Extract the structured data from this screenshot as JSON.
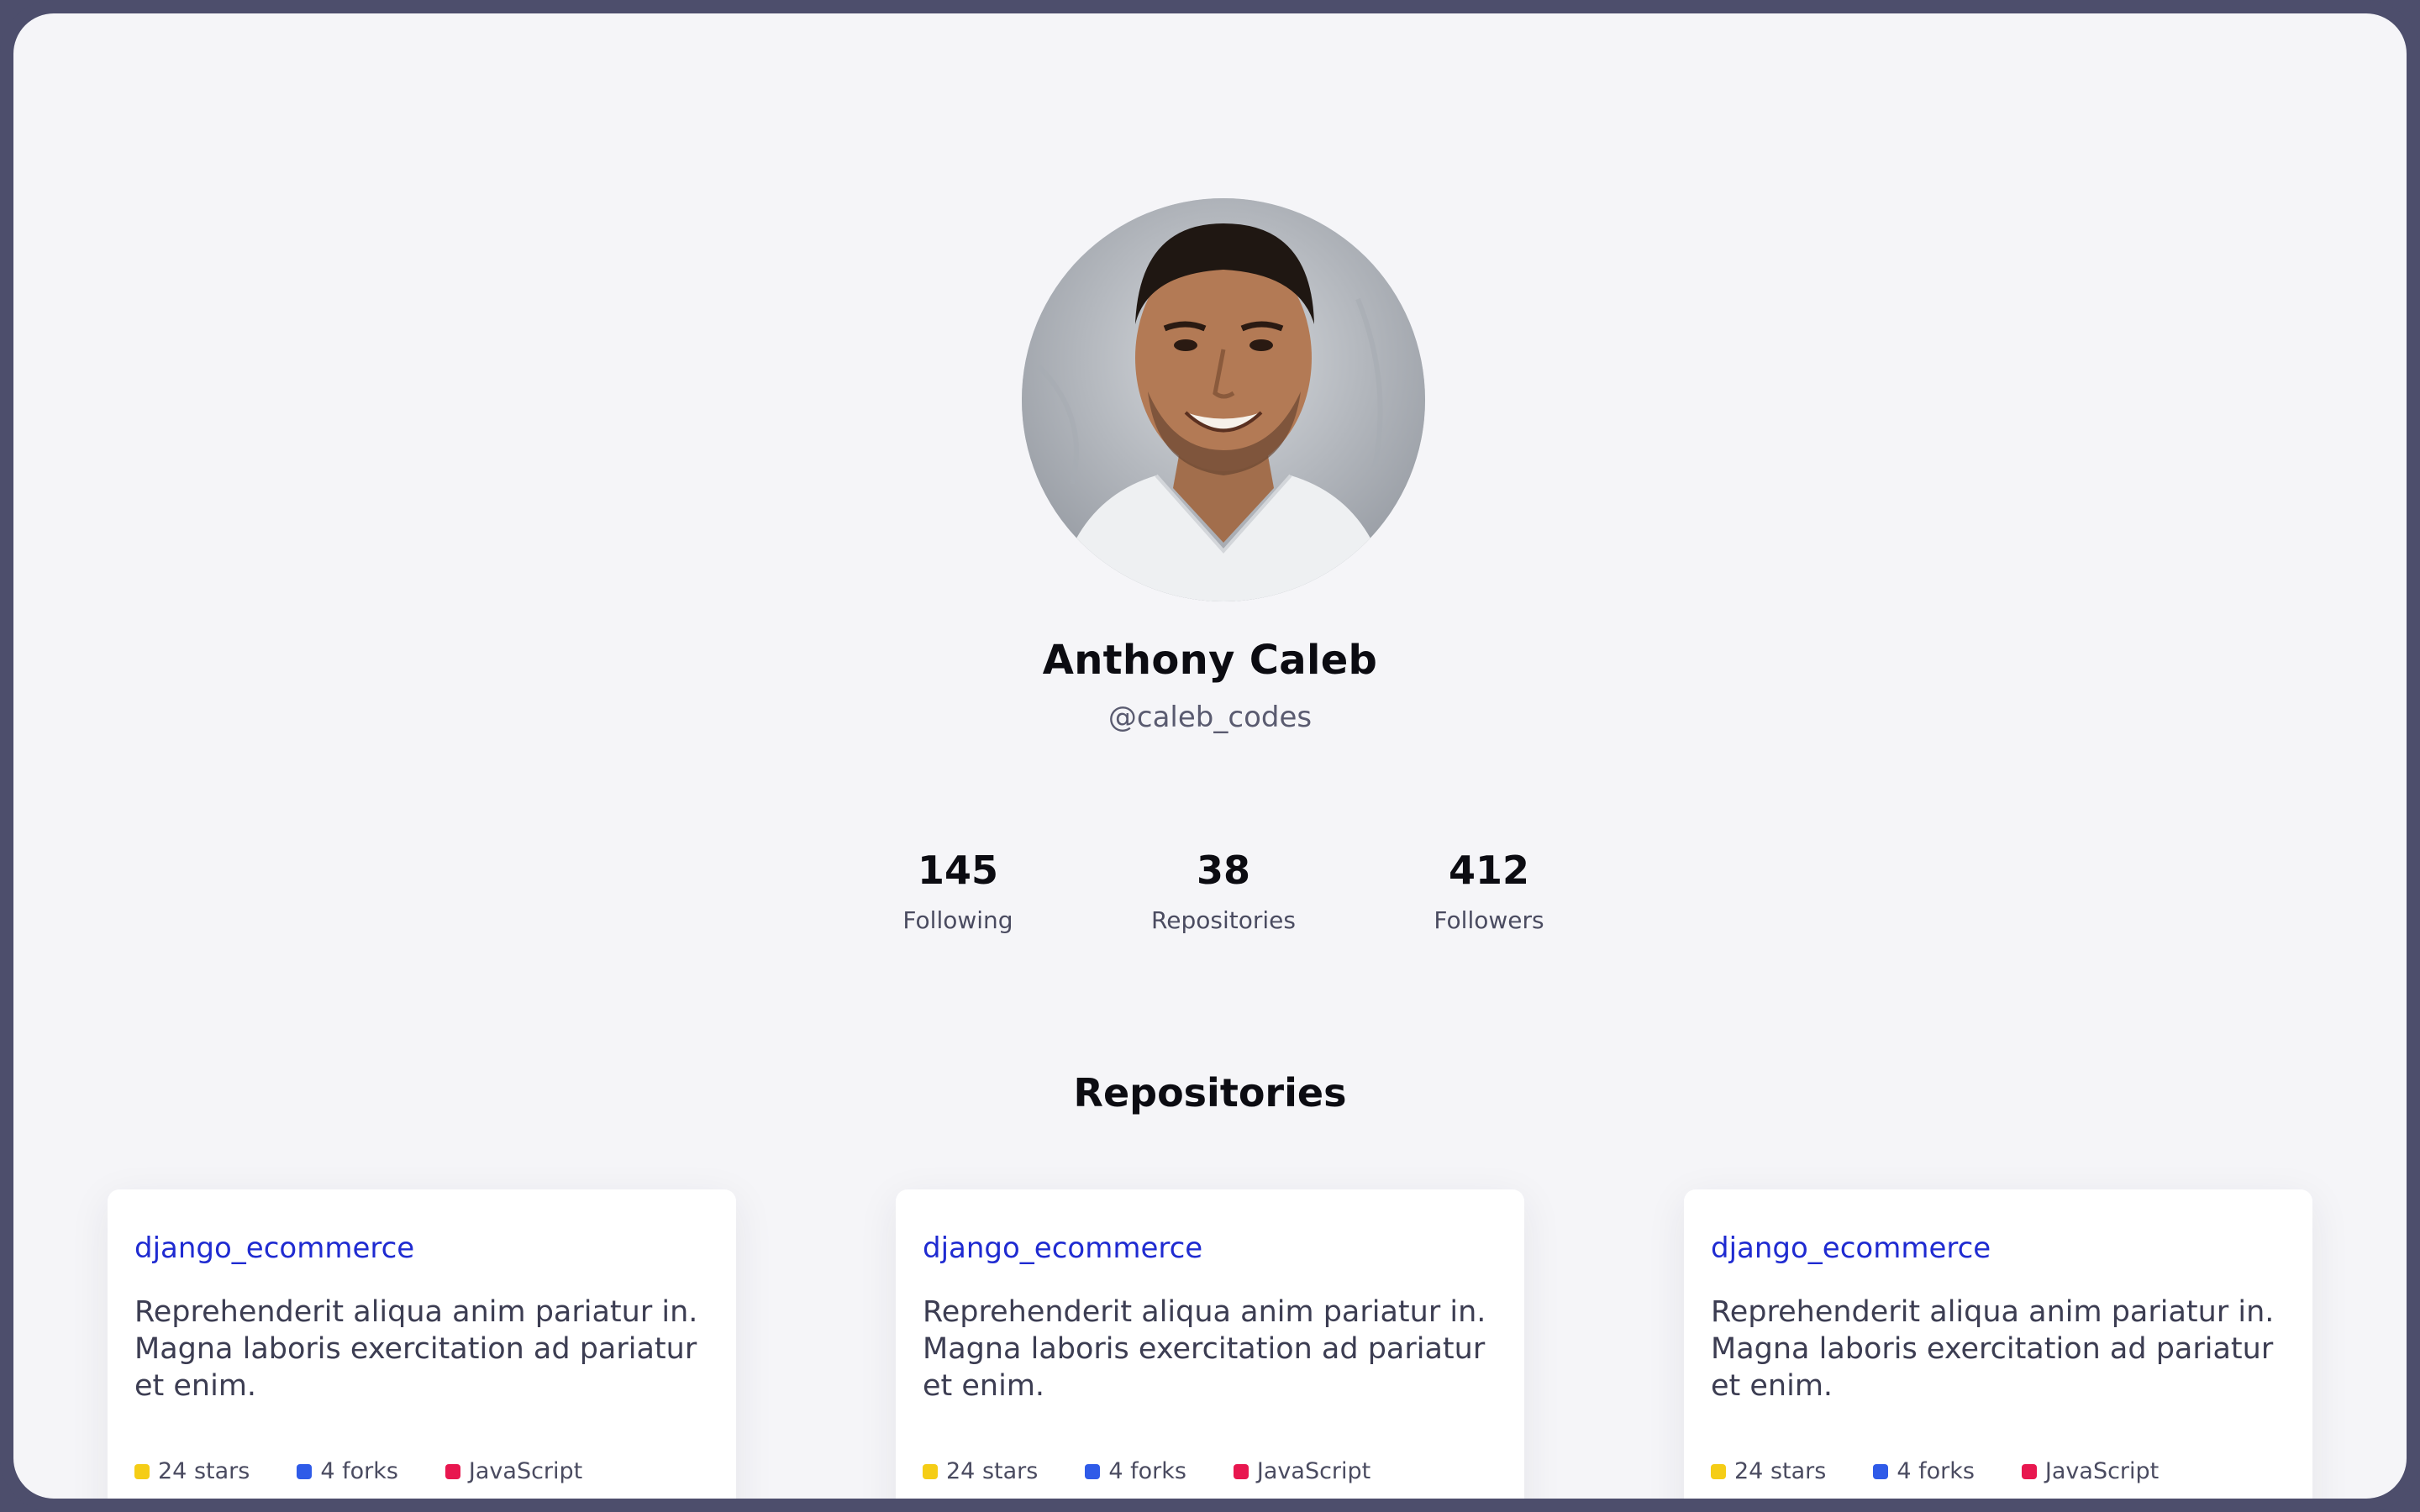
{
  "profile": {
    "name": "Anthony Caleb",
    "handle": "@caleb_codes"
  },
  "stats": [
    {
      "value": "145",
      "label": "Following"
    },
    {
      "value": "38",
      "label": "Repositories"
    },
    {
      "value": "412",
      "label": "Followers"
    }
  ],
  "section": {
    "title": "Repositories"
  },
  "repos": [
    {
      "name": "django_ecommerce",
      "description": "Reprehenderit aliqua anim pariatur in. Magna laboris exercitation ad pariatur et enim.",
      "stars": "24 stars",
      "forks": "4 forks",
      "language": "JavaScript"
    },
    {
      "name": "django_ecommerce",
      "description": "Reprehenderit aliqua anim pariatur in. Magna laboris exercitation ad pariatur et enim.",
      "stars": "24 stars",
      "forks": "4 forks",
      "language": "JavaScript"
    },
    {
      "name": "django_ecommerce",
      "description": "Reprehenderit aliqua anim pariatur in. Magna laboris exercitation ad pariatur et enim.",
      "stars": "24 stars",
      "forks": "4 forks",
      "language": "JavaScript"
    }
  ],
  "colors": {
    "background": "#f5f5f8",
    "frame": "#4d4e6c",
    "link": "#1f2bd1",
    "stars_dot": "#f5cd16",
    "forks_dot": "#2f5be8",
    "language_dot": "#e8174f"
  }
}
